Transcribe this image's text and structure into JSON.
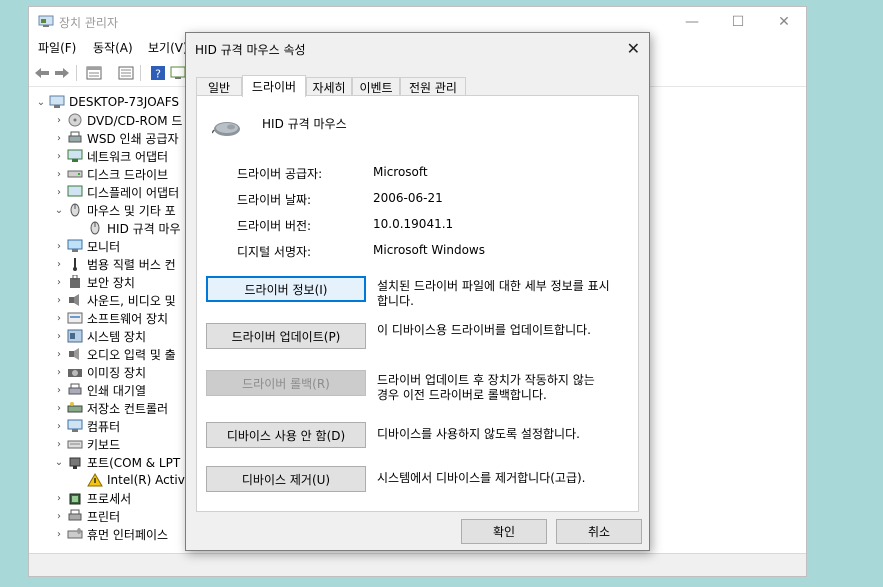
{
  "main_window": {
    "title": "장치 관리자",
    "controls": {
      "minimize": "—",
      "maximize": "☐",
      "close": "✕"
    },
    "menu": [
      "파일(F)",
      "동작(A)",
      "보기(V)"
    ],
    "tree": {
      "root": "DESKTOP-73JOAFS",
      "items": [
        {
          "label": "DVD/CD-ROM 드",
          "icon": "dvd-drive-icon"
        },
        {
          "label": "WSD 인쇄 공급자",
          "icon": "printer-queue-icon"
        },
        {
          "label": "네트워크 어댑터",
          "icon": "network-adapter-icon"
        },
        {
          "label": "디스크 드라이브",
          "icon": "disk-drive-icon"
        },
        {
          "label": "디스플레이 어댑터",
          "icon": "display-adapter-icon"
        },
        {
          "label": "마우스 및 기타 포",
          "icon": "mouse-icon"
        },
        {
          "label": "HID 규격 마우",
          "icon": "mouse-icon"
        },
        {
          "label": "모니터",
          "icon": "monitor-icon"
        },
        {
          "label": "범용 직렬 버스 컨",
          "icon": "usb-icon"
        },
        {
          "label": "보안 장치",
          "icon": "security-device-icon"
        },
        {
          "label": "사운드, 비디오 및",
          "icon": "sound-icon"
        },
        {
          "label": "소프트웨어 장치",
          "icon": "software-device-icon"
        },
        {
          "label": "시스템 장치",
          "icon": "system-device-icon"
        },
        {
          "label": "오디오 입력 및 출",
          "icon": "audio-io-icon"
        },
        {
          "label": "이미징 장치",
          "icon": "imaging-device-icon"
        },
        {
          "label": "인쇄 대기열",
          "icon": "print-queue-icon"
        },
        {
          "label": "저장소 컨트롤러",
          "icon": "storage-controller-icon"
        },
        {
          "label": "컴퓨터",
          "icon": "computer-icon"
        },
        {
          "label": "키보드",
          "icon": "keyboard-icon"
        },
        {
          "label": "포트(COM & LPT",
          "icon": "port-icon"
        },
        {
          "label": "Intel(R) Active",
          "icon": "warning-icon"
        },
        {
          "label": "프로세서",
          "icon": "processor-icon"
        },
        {
          "label": "프린터",
          "icon": "printer-icon"
        },
        {
          "label": "휴먼 인터페이스 ",
          "icon": "hid-icon"
        }
      ]
    }
  },
  "dialog": {
    "title": "HID 규격 마우스 속성",
    "close": "✕",
    "tabs": [
      "일반",
      "드라이버",
      "자세히",
      "이벤트",
      "전원 관리"
    ],
    "active_tab": "드라이버",
    "device_name": "HID 규격 마우스",
    "properties": [
      {
        "label": "드라이버 공급자:",
        "value": "Microsoft"
      },
      {
        "label": "드라이버 날짜:",
        "value": "2006-06-21"
      },
      {
        "label": "드라이버 버전:",
        "value": "10.0.19041.1"
      },
      {
        "label": "디지털 서명자:",
        "value": "Microsoft Windows"
      }
    ],
    "actions": [
      {
        "button": "드라이버 정보(I)",
        "desc_lines": [
          "설치된 드라이버 파일에 대한 세부 정보를 표시",
          "합니다."
        ]
      },
      {
        "button": "드라이버 업데이트(P)",
        "desc_lines": [
          "이 디바이스용 드라이버를 업데이트합니다."
        ]
      },
      {
        "button": "드라이버 롤백(R)",
        "desc_lines": [
          "드라이버 업데이트 후 장치가 작동하지 않는",
          "경우 이전 드라이버로 롤백합니다."
        ]
      },
      {
        "button": "디바이스 사용 안 함(D)",
        "desc_lines": [
          "디바이스를 사용하지 않도록 설정합니다."
        ]
      },
      {
        "button": "디바이스 제거(U)",
        "desc_lines": [
          "시스템에서 디바이스를 제거합니다(고급)."
        ]
      }
    ],
    "ok_label": "확인",
    "cancel_label": "취소"
  },
  "colors": {
    "desktop": "#a9d8d9",
    "focus": "#0078d7",
    "dialog_bg": "#f0f0f0"
  }
}
